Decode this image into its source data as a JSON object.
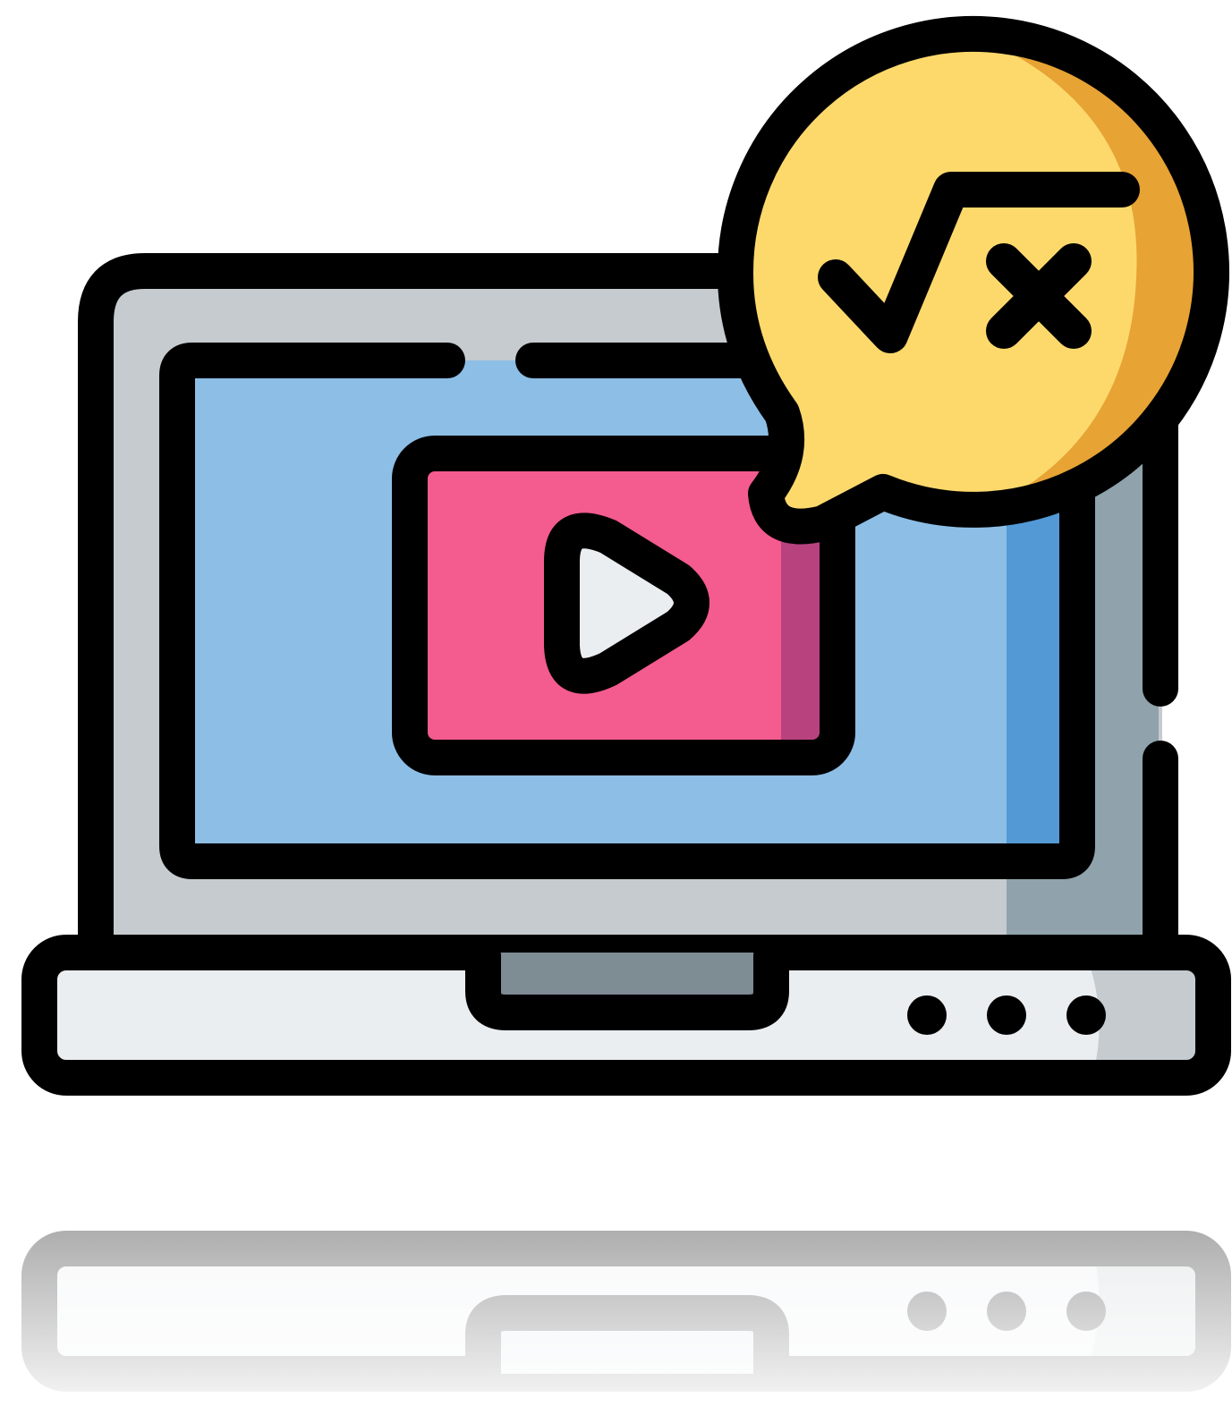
{
  "illustration": {
    "name": "online-math-video-lesson-icon",
    "palette": {
      "outline": "#000000",
      "laptop_lid": "#c5cbce",
      "laptop_lid_shade": "#90a3ac",
      "laptop_base": "#ebeef1",
      "laptop_base_shade": "#c5cbce",
      "trackpad": "#7e8c93",
      "screen": "#8dbee6",
      "screen_shade": "#5299d6",
      "video_player": "#f45b8e",
      "video_player_shade": "#b8427e",
      "play_button": "#ebeef1",
      "speech_bubble": "#fdd96c",
      "speech_bubble_shade": "#e7a334"
    },
    "icons": [
      "laptop-icon",
      "video-player-icon",
      "play-icon",
      "speech-bubble-icon",
      "square-root-x-icon",
      "indicator-dots-icon"
    ],
    "has_reflection": true
  }
}
